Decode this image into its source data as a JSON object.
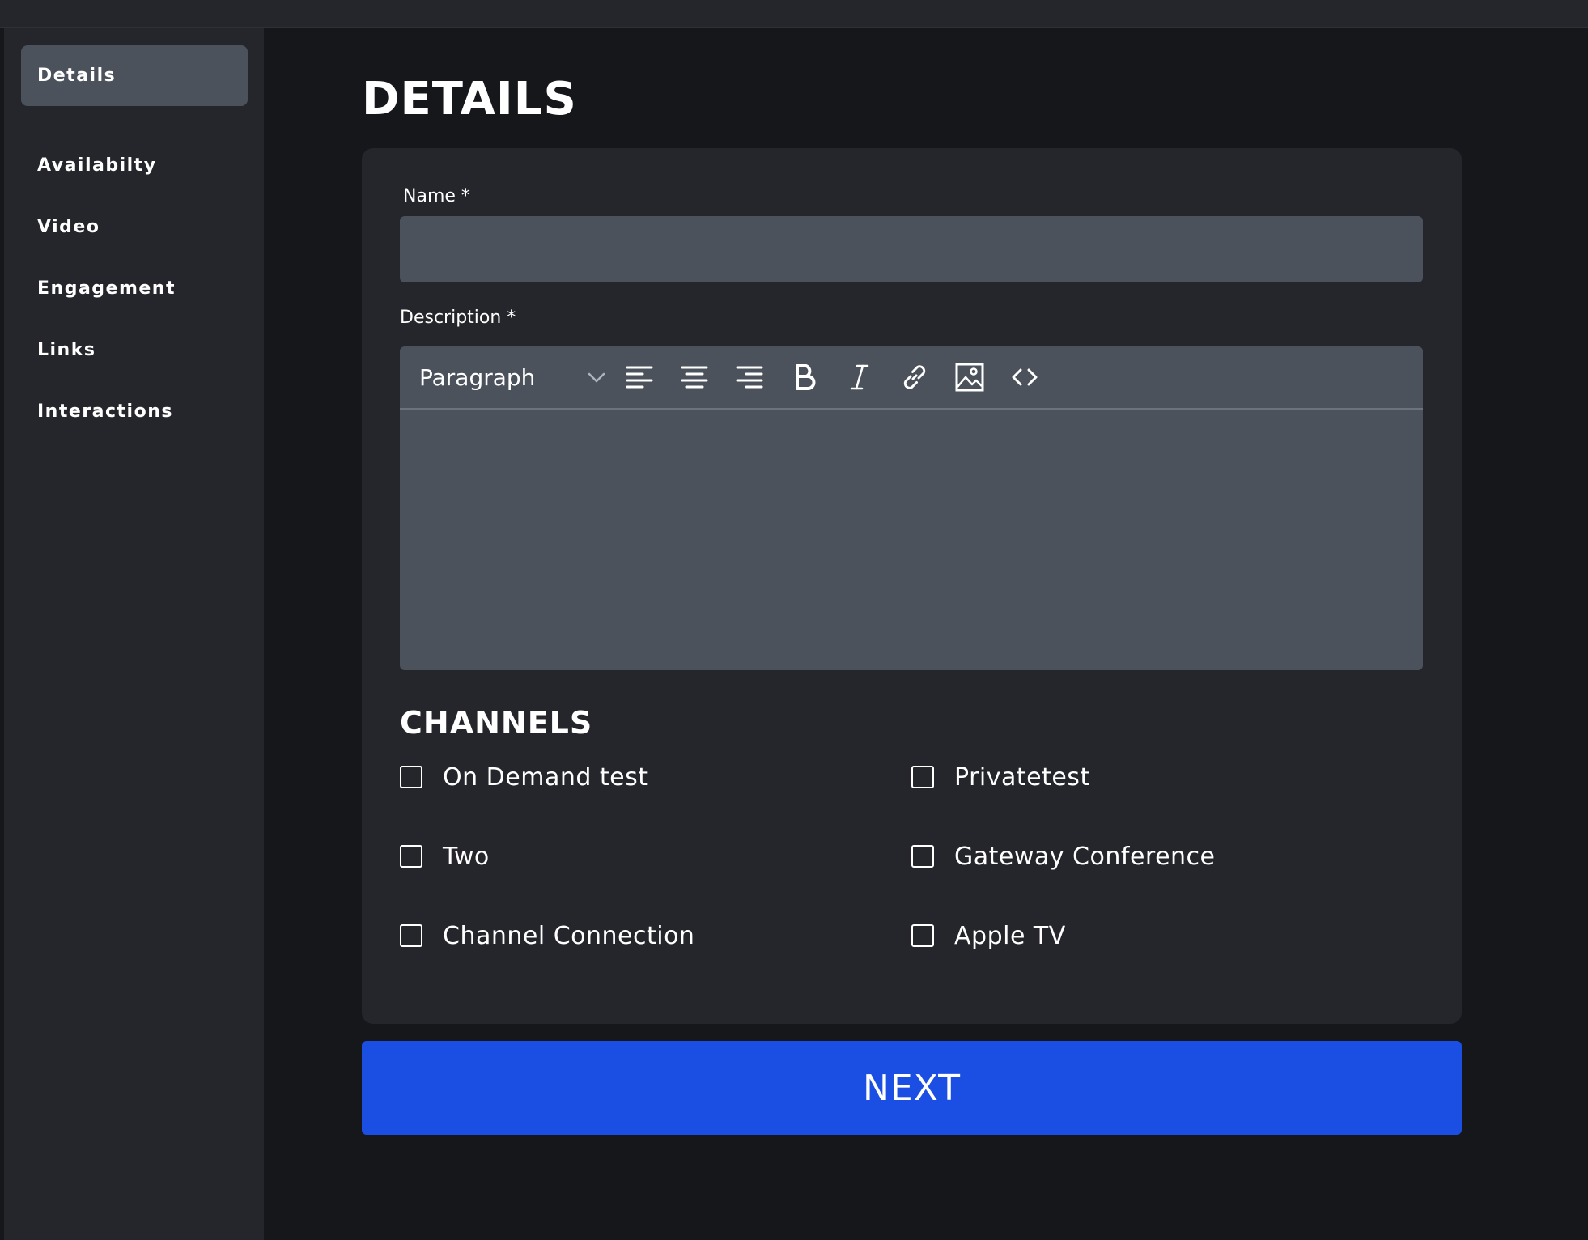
{
  "sidebar": {
    "items": [
      {
        "label": "Details",
        "active": true
      },
      {
        "label": "Availabilty",
        "active": false
      },
      {
        "label": "Video",
        "active": false
      },
      {
        "label": "Engagement",
        "active": false
      },
      {
        "label": "Links",
        "active": false
      },
      {
        "label": "Interactions",
        "active": false
      }
    ]
  },
  "page": {
    "title": "DETAILS"
  },
  "form": {
    "name_label": "Name *",
    "name_value": "",
    "description_label": "Description *",
    "description_value": "",
    "editor": {
      "format_value": "Paragraph",
      "tools": [
        "align-left-icon",
        "align-center-icon",
        "align-right-icon",
        "bold-icon",
        "italic-icon",
        "link-icon",
        "image-icon",
        "code-icon"
      ]
    },
    "channels_title": "CHANNELS",
    "channels": [
      {
        "label": "On Demand test",
        "checked": false
      },
      {
        "label": "Privatetest",
        "checked": false
      },
      {
        "label": "Two",
        "checked": false
      },
      {
        "label": "Gateway Conference",
        "checked": false
      },
      {
        "label": "Channel Connection",
        "checked": false
      },
      {
        "label": "Apple TV",
        "checked": false
      }
    ],
    "next_label": "NEXT"
  },
  "colors": {
    "background": "#16171b",
    "panel": "#25262b",
    "input": "#4b525b",
    "accent": "#1b4fe4",
    "text": "#ffffff"
  }
}
